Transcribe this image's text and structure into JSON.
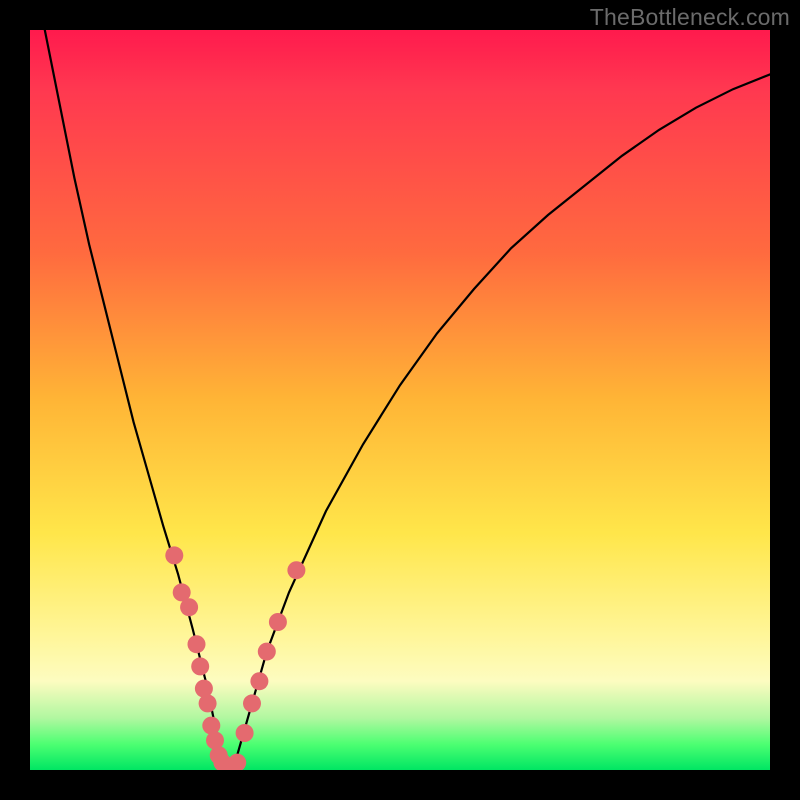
{
  "watermark": {
    "text": "TheBottleneck.com"
  },
  "chart_data": {
    "type": "line",
    "title": "",
    "xlabel": "",
    "ylabel": "",
    "xlim": [
      0,
      100
    ],
    "ylim": [
      0,
      100
    ],
    "grid": false,
    "legend": false,
    "background_gradient_stops": [
      {
        "pos": 0,
        "color": "#ff1a4d"
      },
      {
        "pos": 0.3,
        "color": "#ff6a3f"
      },
      {
        "pos": 0.5,
        "color": "#ffb536"
      },
      {
        "pos": 0.68,
        "color": "#ffe64a"
      },
      {
        "pos": 0.88,
        "color": "#fdfcc0"
      },
      {
        "pos": 0.965,
        "color": "#4dff72"
      },
      {
        "pos": 1.0,
        "color": "#00e663"
      }
    ],
    "series": [
      {
        "name": "bottleneck-curve",
        "color": "#000000",
        "x": [
          2,
          4,
          6,
          8,
          10,
          12,
          14,
          16,
          18,
          20,
          22,
          24,
          25,
          26,
          27,
          28,
          30,
          32,
          35,
          40,
          45,
          50,
          55,
          60,
          65,
          70,
          75,
          80,
          85,
          90,
          95,
          100
        ],
        "y": [
          100,
          90,
          80,
          71,
          63,
          55,
          47,
          40,
          33,
          26.5,
          19,
          11,
          6,
          2,
          0,
          2,
          9,
          16,
          24,
          35,
          44,
          52,
          59,
          65,
          70.5,
          75,
          79,
          83,
          86.5,
          89.5,
          92,
          94
        ]
      }
    ],
    "scatter_points": {
      "name": "sample-dots",
      "color": "#e46a6f",
      "radius_px": 9,
      "points": [
        {
          "x": 19.5,
          "y": 29
        },
        {
          "x": 20.5,
          "y": 24
        },
        {
          "x": 21.5,
          "y": 22
        },
        {
          "x": 22.5,
          "y": 17
        },
        {
          "x": 23,
          "y": 14
        },
        {
          "x": 23.5,
          "y": 11
        },
        {
          "x": 24,
          "y": 9
        },
        {
          "x": 24.5,
          "y": 6
        },
        {
          "x": 25,
          "y": 4
        },
        {
          "x": 25.5,
          "y": 2
        },
        {
          "x": 26,
          "y": 1
        },
        {
          "x": 27,
          "y": 0
        },
        {
          "x": 28,
          "y": 1
        },
        {
          "x": 29,
          "y": 5
        },
        {
          "x": 30,
          "y": 9
        },
        {
          "x": 31,
          "y": 12
        },
        {
          "x": 32,
          "y": 16
        },
        {
          "x": 33.5,
          "y": 20
        },
        {
          "x": 36,
          "y": 27
        }
      ]
    }
  }
}
